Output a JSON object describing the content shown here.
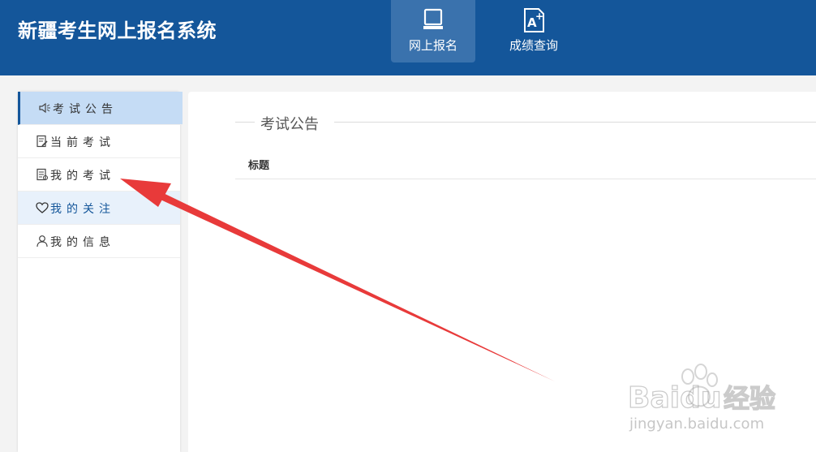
{
  "header": {
    "title": "新疆考生网上报名系统",
    "nav": [
      {
        "label": "网上报名",
        "icon": "monitor-icon",
        "active": true
      },
      {
        "label": "成绩查询",
        "icon": "grade-document-icon",
        "active": false
      }
    ]
  },
  "sidebar": {
    "items": [
      {
        "label": "考试公告",
        "icon": "speaker-icon",
        "state": "active"
      },
      {
        "label": "当前考试",
        "icon": "edit-document-icon",
        "state": "normal"
      },
      {
        "label": "我的考试",
        "icon": "document-list-icon",
        "state": "normal"
      },
      {
        "label": "我的关注",
        "icon": "heart-icon",
        "state": "hover"
      },
      {
        "label": "我的信息",
        "icon": "user-icon",
        "state": "normal"
      }
    ]
  },
  "main": {
    "section_title": "考试公告",
    "table": {
      "columns": [
        "标题"
      ]
    }
  },
  "annotation": {
    "arrow_color": "#e83a3a"
  },
  "watermark": {
    "brand": "Baidu",
    "brand_cn": "经验",
    "url": "jingyan.baidu.com"
  },
  "colors": {
    "header_bg": "#14569a",
    "active_item_bg": "#c5dcf5",
    "accent": "#14569a"
  }
}
